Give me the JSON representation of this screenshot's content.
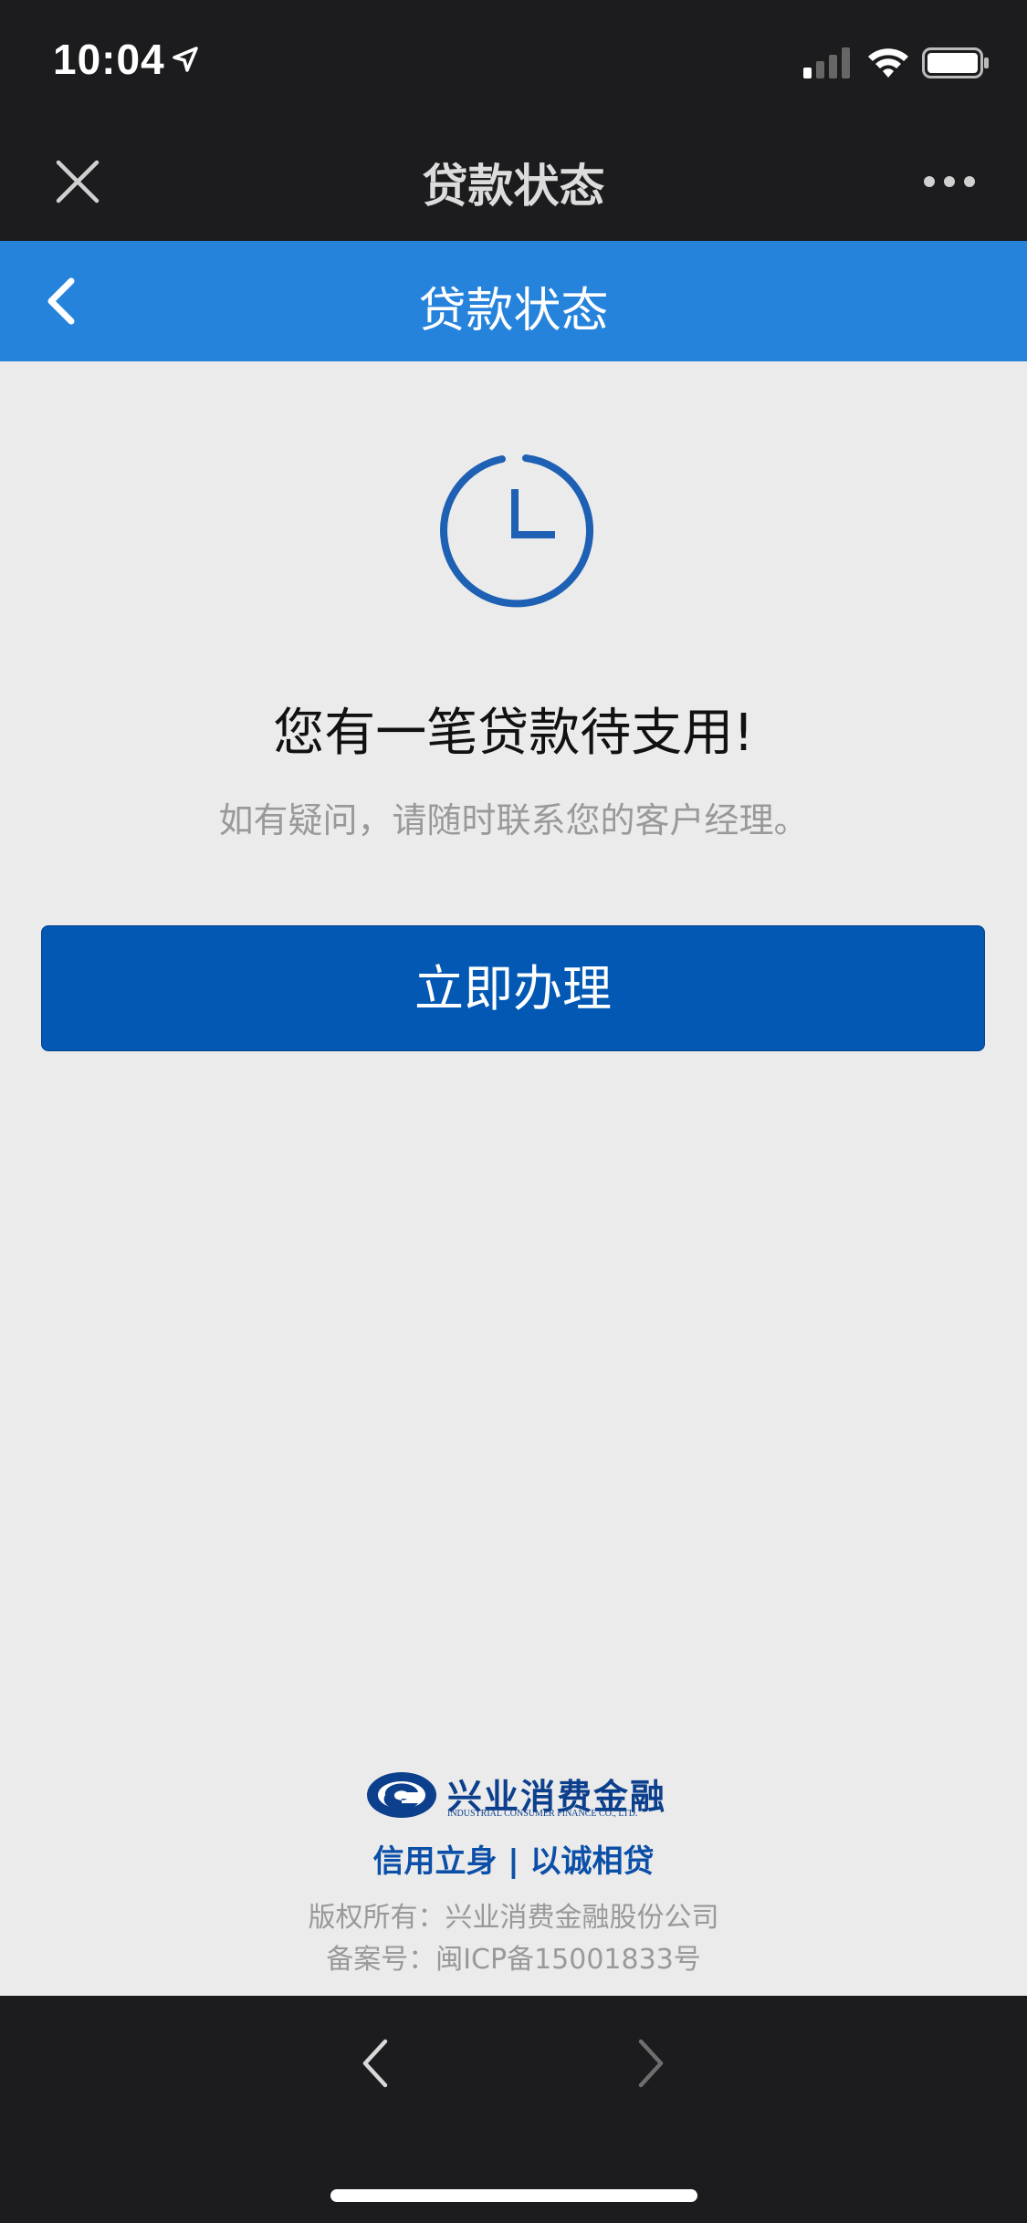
{
  "status_bar": {
    "time": "10:04"
  },
  "nav_bar": {
    "title": "贷款状态"
  },
  "page_header": {
    "title": "贷款状态"
  },
  "message": {
    "title": "您有一笔贷款待支用!",
    "subtitle": "如有疑问，请随时联系您的客户经理。"
  },
  "action_button": {
    "label": "立即办理"
  },
  "footer": {
    "logo_cn": "兴业消费金融",
    "logo_en": "INDUSTRIAL CONSUMER FINANCE CO., LTD.",
    "slogan": "信用立身 | 以诚相贷",
    "copyright": "版权所有：兴业消费金融股份公司",
    "icp": "备案号：闽ICP备15001833号"
  },
  "colors": {
    "header_blue": "#2683dc",
    "button_blue": "#0258b3",
    "brand_navy": "#0c3f8c",
    "background": "#ebebeb"
  }
}
